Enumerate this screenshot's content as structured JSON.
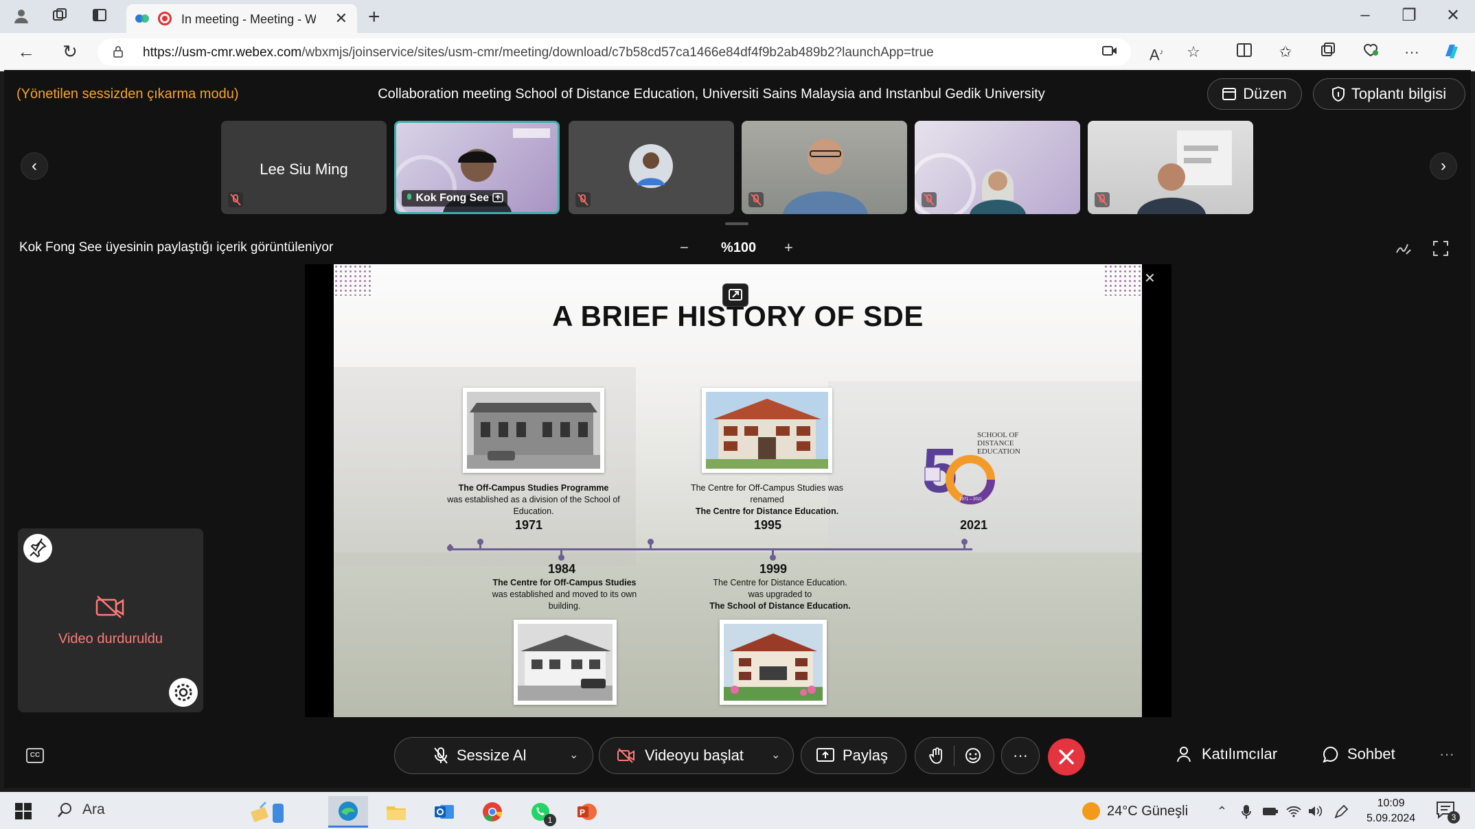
{
  "browser": {
    "tab_title": "In meeting - Meeting - Webe",
    "url_host": "https://usm-cmr.webex.com",
    "url_path": "/wbxmjs/joinservice/sites/usm-cmr/meeting/download/c7b58cd57ca1466e84df4f9b2ab489b2?launchApp=true"
  },
  "meeting": {
    "mode_text": "(Yönetilen sessizden çıkarma modu)",
    "title": "Collaboration meeting School of Distance Education, Universiti Sains Malaysia and Instanbul Gedik University",
    "layout_button": "Düzen",
    "info_button": "Toplantı bilgisi"
  },
  "participants": [
    {
      "name": "Lee Siu Ming"
    },
    {
      "name": "Kok Fong See"
    },
    {
      "name": ""
    },
    {
      "name": ""
    },
    {
      "name": ""
    },
    {
      "name": ""
    }
  ],
  "share": {
    "info": "Kok Fong See üyesinin paylaştığı içerik görüntüleniyor",
    "zoom": "%100",
    "zoom_minus": "−",
    "zoom_plus": "+"
  },
  "slide": {
    "title": "A BRIEF HISTORY OF SDE",
    "events": [
      {
        "year": "1971",
        "bold": "The Off-Campus Studies Programme",
        "text": "was established as a division of the School of Education."
      },
      {
        "year": "1995",
        "text": "The Centre for Off-Campus Studies was renamed",
        "bold": "The Centre for Distance Education."
      },
      {
        "year": "2021"
      },
      {
        "year": "1984",
        "bold": "The Centre for Off-Campus Studies",
        "text": "was established and moved to its own building."
      },
      {
        "year": "1999",
        "text": "The Centre for Distance Education. was upgraded to",
        "bold": "The School of Distance Education."
      }
    ],
    "logo": {
      "line1": "SCHOOL OF",
      "line2": "DISTANCE",
      "line3": "EDUCATION",
      "years": "1971 – 2021"
    }
  },
  "selfview": {
    "status": "Video durduruldu"
  },
  "controls": {
    "mute": "Sessize Al",
    "video": "Videoyu başlat",
    "share": "Paylaş",
    "participants": "Katılımcılar",
    "chat": "Sohbet",
    "more": "···"
  },
  "taskbar": {
    "search": "Ara",
    "weather": "24°C Güneşli",
    "time": "10:09",
    "date": "5.09.2024",
    "notif_count": "3",
    "whatsapp_badge": "1"
  },
  "colors": {
    "accent_orange": "#f5a623",
    "end_call": "#e3343f",
    "active_border": "#3ab0a8",
    "timeline": "#6e5e94"
  }
}
